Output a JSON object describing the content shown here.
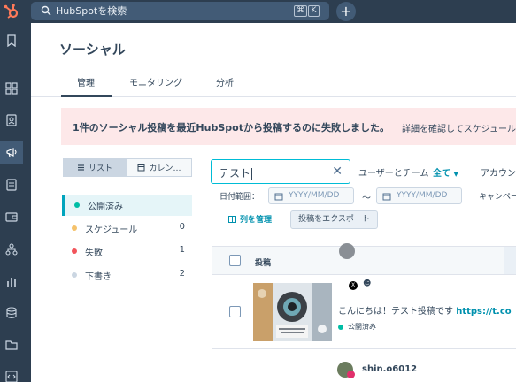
{
  "topbar": {
    "search_placeholder": "HubSpotを検索",
    "shortcut_keys": [
      "⌘",
      "K"
    ],
    "add_label": "+"
  },
  "sidebar": {
    "items": [
      "bookmark-icon",
      "grid-icon",
      "contacts-icon",
      "megaphone-icon",
      "document-icon",
      "wallet-icon",
      "network-icon",
      "chart-icon",
      "database-icon",
      "folder-icon",
      "code-icon"
    ],
    "active": "megaphone-icon"
  },
  "page": {
    "title": "ソーシャル",
    "tabs": [
      {
        "label": "管理",
        "active": true
      },
      {
        "label": "モニタリング",
        "active": false
      },
      {
        "label": "分析",
        "active": false
      }
    ]
  },
  "banner": {
    "message": "1件のソーシャル投稿を最近HubSpotから投稿するのに失敗しました。",
    "link": "詳細を確認してスケジュールを"
  },
  "view_toggle": {
    "list_label": "リスト",
    "calendar_label": "カレン…",
    "active": "list"
  },
  "status_list": [
    {
      "label": "公開済み",
      "count": "",
      "color": "#00bda5",
      "active": true
    },
    {
      "label": "スケジュール",
      "count": "0",
      "color": "#f5c26b",
      "active": false
    },
    {
      "label": "失敗",
      "count": "1",
      "color": "#f2545b",
      "active": false
    },
    {
      "label": "下書き",
      "count": "2",
      "color": "#cbd6e2",
      "active": false
    }
  ],
  "filters": {
    "search_value": "テスト",
    "users_teams_label": "ユーザーとチーム",
    "users_teams_value": "全て",
    "account_label": "アカウン",
    "date_range_label": "日付範囲：",
    "date_placeholder": "YYYY/MM/DD",
    "date_separator": "〜",
    "campaign_label": "キャンペー"
  },
  "actions": {
    "manage_columns": "列を管理",
    "export_posts": "投稿をエクスポート"
  },
  "table": {
    "header": "投稿",
    "rows": [
      {
        "text": "こんにちは！テスト投稿です",
        "link": "https://t.co",
        "status": "公開済み"
      }
    ],
    "next_username": "shin.o6012"
  },
  "colors": {
    "nav_bg": "#2d3e50",
    "accent": "#00bcd6",
    "link": "#0091ae",
    "banner_bg": "#fde8e9"
  }
}
